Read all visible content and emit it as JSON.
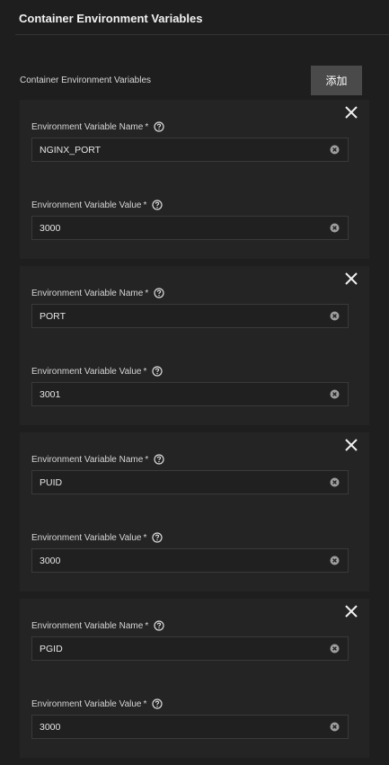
{
  "header": {
    "title": "Container Environment Variables"
  },
  "list": {
    "label": "Container Environment Variables",
    "add_label": "添加"
  },
  "fields": {
    "name_label": "Environment Variable Name",
    "value_label": "Environment Variable Value",
    "required_mark": "*"
  },
  "entries": [
    {
      "name": "NGINX_PORT",
      "value": "3000"
    },
    {
      "name": "PORT",
      "value": "3001"
    },
    {
      "name": "PUID",
      "value": "3000"
    },
    {
      "name": "PGID",
      "value": "3000"
    }
  ],
  "icons": {
    "remove": "close-icon",
    "help": "help-circle-icon",
    "clear": "clear-circle-icon"
  }
}
